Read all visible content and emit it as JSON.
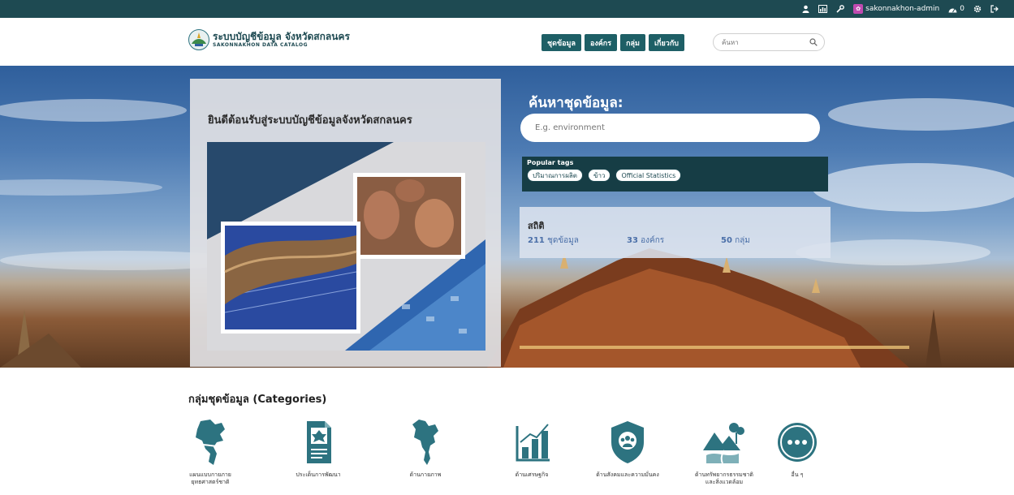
{
  "topbar": {
    "username": "sakonnakhon-admin",
    "notifications_count": "0",
    "colors": {
      "bar": "#1e4a52"
    }
  },
  "header": {
    "logo_title": "ระบบบัญชีข้อมูล จังหวัดสกลนคร",
    "logo_subtitle": "SAKONNAKHON DATA CATALOG",
    "nav": [
      {
        "label": "ชุดข้อมูล"
      },
      {
        "label": "องค์กร"
      },
      {
        "label": "กลุ่ม"
      },
      {
        "label": "เกี่ยวกับ"
      }
    ],
    "search_placeholder": "ค้นหา",
    "colors": {
      "nav": "#1e5f66"
    }
  },
  "hero": {
    "welcome_title": "ยินดีต้อนรับสู่ระบบบัญชีข้อมูลจังหวัดสกลนคร",
    "search_title": "ค้นหาชุดข้อมูล:",
    "search_placeholder": "E.g. environment",
    "popular_tags_title": "Popular tags",
    "tags": [
      {
        "label": "ปริมาณการผลิต"
      },
      {
        "label": "ข้าว"
      },
      {
        "label": "Official Statistics"
      }
    ],
    "stats_title": "สถิติ",
    "stats": [
      {
        "number": "211",
        "label": "ชุดข้อมูล"
      },
      {
        "number": "33",
        "label": "องค์กร"
      },
      {
        "number": "50",
        "label": "กลุ่ม"
      }
    ]
  },
  "categories": {
    "heading": "กลุ่มชุดข้อมูล (Categories)",
    "items": [
      {
        "line1": "แผนแบบกายภาย",
        "line2": "ยุทธศาสตร์ชาติ",
        "icon": "thailand-map-icon"
      },
      {
        "line1": "ประเด็นการพัฒนา",
        "line2": "",
        "icon": "document-icon"
      },
      {
        "line1": "ด้านกายภาพ",
        "line2": "",
        "icon": "thailand-map-icon"
      },
      {
        "line1": "ด้านเศรษฐกิจ",
        "line2": "",
        "icon": "bar-chart-icon"
      },
      {
        "line1": "ด้านสังคมและความมั่นคง",
        "line2": "",
        "icon": "people-shield-icon"
      },
      {
        "line1": "ด้านทรัพยากรธรรมชาติ",
        "line2": "และสิ่งแวดล้อม",
        "icon": "nature-icon"
      },
      {
        "line1": "อื่น ๆ",
        "line2": "",
        "icon": "more-icon"
      }
    ],
    "colors": {
      "icon": "#2d7380"
    }
  }
}
